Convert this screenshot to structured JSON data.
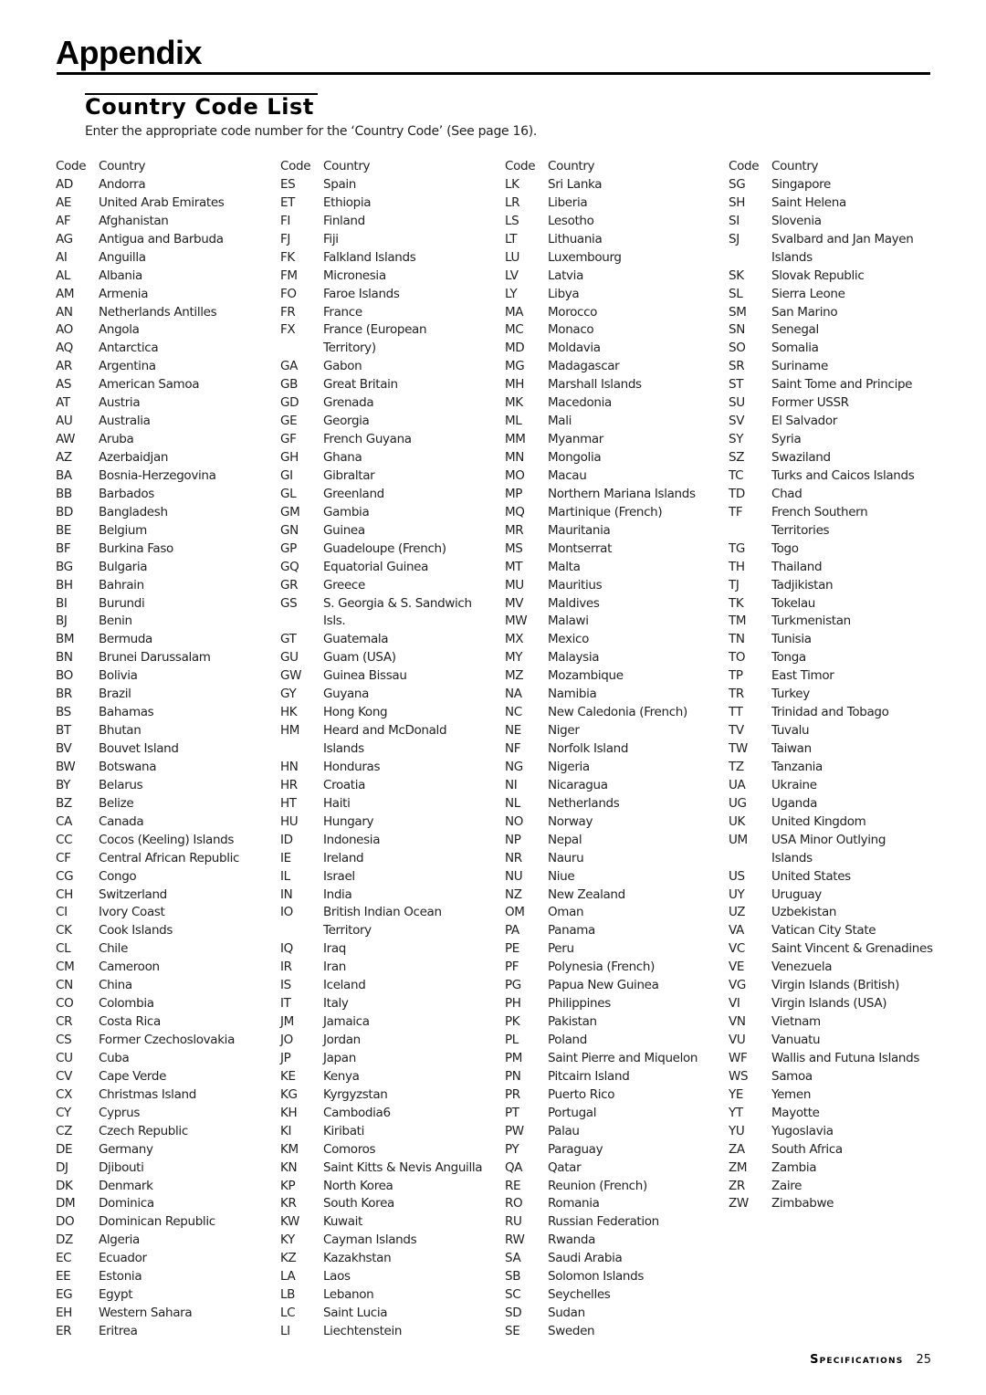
{
  "page": {
    "title": "Appendix",
    "section_title": "Country Code List",
    "intro": "Enter the appropriate code number for the ‘Country Code’ (See page 16).",
    "footer": {
      "section": "Specifications",
      "page_number": "25"
    }
  },
  "table_headers": {
    "code": "Code",
    "country": "Country"
  },
  "columns": [
    [
      [
        "AD",
        "Andorra"
      ],
      [
        "AE",
        "United Arab Emirates"
      ],
      [
        "AF",
        "Afghanistan"
      ],
      [
        "AG",
        "Antigua and Barbuda"
      ],
      [
        "AI",
        "Anguilla"
      ],
      [
        "AL",
        "Albania"
      ],
      [
        "AM",
        "Armenia"
      ],
      [
        "AN",
        "Netherlands Antilles"
      ],
      [
        "AO",
        "Angola"
      ],
      [
        "AQ",
        "Antarctica"
      ],
      [
        "AR",
        "Argentina"
      ],
      [
        "AS",
        "American Samoa"
      ],
      [
        "AT",
        "Austria"
      ],
      [
        "AU",
        "Australia"
      ],
      [
        "AW",
        "Aruba"
      ],
      [
        "AZ",
        "Azerbaidjan"
      ],
      [
        "BA",
        "Bosnia-Herzegovina"
      ],
      [
        "BB",
        "Barbados"
      ],
      [
        "BD",
        "Bangladesh"
      ],
      [
        "BE",
        "Belgium"
      ],
      [
        "BF",
        "Burkina Faso"
      ],
      [
        "BG",
        "Bulgaria"
      ],
      [
        "BH",
        "Bahrain"
      ],
      [
        "BI",
        "Burundi"
      ],
      [
        "BJ",
        "Benin"
      ],
      [
        "BM",
        "Bermuda"
      ],
      [
        "BN",
        "Brunei Darussalam"
      ],
      [
        "BO",
        "Bolivia"
      ],
      [
        "BR",
        "Brazil"
      ],
      [
        "BS",
        "Bahamas"
      ],
      [
        "BT",
        "Bhutan"
      ],
      [
        "BV",
        "Bouvet Island"
      ],
      [
        "BW",
        "Botswana"
      ],
      [
        "BY",
        "Belarus"
      ],
      [
        "BZ",
        "Belize"
      ],
      [
        "CA",
        "Canada"
      ],
      [
        "CC",
        "Cocos (Keeling) Islands"
      ],
      [
        "CF",
        "Central African Republic"
      ],
      [
        "CG",
        "Congo"
      ],
      [
        "CH",
        "Switzerland"
      ],
      [
        "CI",
        "Ivory Coast"
      ],
      [
        "CK",
        "Cook Islands"
      ],
      [
        "CL",
        "Chile"
      ],
      [
        "CM",
        "Cameroon"
      ],
      [
        "CN",
        "China"
      ],
      [
        "CO",
        "Colombia"
      ],
      [
        "CR",
        "Costa Rica"
      ],
      [
        "CS",
        "Former Czechoslovakia"
      ],
      [
        "CU",
        "Cuba"
      ],
      [
        "CV",
        "Cape Verde"
      ],
      [
        "CX",
        "Christmas Island"
      ],
      [
        "CY",
        "Cyprus"
      ],
      [
        "CZ",
        "Czech Republic"
      ],
      [
        "DE",
        "Germany"
      ],
      [
        "DJ",
        "Djibouti"
      ],
      [
        "DK",
        "Denmark"
      ],
      [
        "DM",
        "Dominica"
      ],
      [
        "DO",
        "Dominican Republic"
      ],
      [
        "DZ",
        "Algeria"
      ],
      [
        "EC",
        "Ecuador"
      ],
      [
        "EE",
        "Estonia"
      ],
      [
        "EG",
        "Egypt"
      ],
      [
        "EH",
        "Western Sahara"
      ],
      [
        "ER",
        "Eritrea"
      ]
    ],
    [
      [
        "ES",
        "Spain"
      ],
      [
        "ET",
        "Ethiopia"
      ],
      [
        "FI",
        "Finland"
      ],
      [
        "FJ",
        "Fiji"
      ],
      [
        "FK",
        "Falkland Islands"
      ],
      [
        "FM",
        "Micronesia"
      ],
      [
        "FO",
        "Faroe Islands"
      ],
      [
        "FR",
        "France"
      ],
      [
        "FX",
        "France (European",
        "Territory)"
      ],
      [
        "GA",
        "Gabon"
      ],
      [
        "GB",
        "Great Britain"
      ],
      [
        "GD",
        "Grenada"
      ],
      [
        "GE",
        "Georgia"
      ],
      [
        "GF",
        "French Guyana"
      ],
      [
        "GH",
        "Ghana"
      ],
      [
        "GI",
        "Gibraltar"
      ],
      [
        "GL",
        "Greenland"
      ],
      [
        "GM",
        "Gambia"
      ],
      [
        "GN",
        "Guinea"
      ],
      [
        "GP",
        "Guadeloupe (French)"
      ],
      [
        "GQ",
        "Equatorial Guinea"
      ],
      [
        "GR",
        "Greece"
      ],
      [
        "GS",
        "S. Georgia & S. Sandwich",
        "Isls."
      ],
      [
        "GT",
        "Guatemala"
      ],
      [
        "GU",
        "Guam (USA)"
      ],
      [
        "GW",
        "Guinea Bissau"
      ],
      [
        "GY",
        "Guyana"
      ],
      [
        "HK",
        "Hong Kong"
      ],
      [
        "HM",
        "Heard and McDonald",
        "Islands"
      ],
      [
        "HN",
        "Honduras"
      ],
      [
        "HR",
        "Croatia"
      ],
      [
        "HT",
        "Haiti"
      ],
      [
        "HU",
        "Hungary"
      ],
      [
        "ID",
        "Indonesia"
      ],
      [
        "IE",
        "Ireland"
      ],
      [
        "IL",
        "Israel"
      ],
      [
        "IN",
        "India"
      ],
      [
        "IO",
        "British Indian Ocean",
        "Territory"
      ],
      [
        "IQ",
        "Iraq"
      ],
      [
        "IR",
        "Iran"
      ],
      [
        "IS",
        "Iceland"
      ],
      [
        "IT",
        "Italy"
      ],
      [
        "JM",
        "Jamaica"
      ],
      [
        "JO",
        "Jordan"
      ],
      [
        "JP",
        "Japan"
      ],
      [
        "KE",
        "Kenya"
      ],
      [
        "KG",
        "Kyrgyzstan"
      ],
      [
        "KH",
        "Cambodia6"
      ],
      [
        "KI",
        "Kiribati"
      ],
      [
        "KM",
        "Comoros"
      ],
      [
        "KN",
        "Saint Kitts & Nevis Anguilla"
      ],
      [
        "KP",
        "North Korea"
      ],
      [
        "KR",
        "South Korea"
      ],
      [
        "KW",
        "Kuwait"
      ],
      [
        "KY",
        "Cayman Islands"
      ],
      [
        "KZ",
        "Kazakhstan"
      ],
      [
        "LA",
        "Laos"
      ],
      [
        "LB",
        "Lebanon"
      ],
      [
        "LC",
        "Saint Lucia"
      ],
      [
        "LI",
        "Liechtenstein"
      ]
    ],
    [
      [
        "LK",
        "Sri Lanka"
      ],
      [
        "LR",
        "Liberia"
      ],
      [
        "LS",
        "Lesotho"
      ],
      [
        "LT",
        "Lithuania"
      ],
      [
        "LU",
        "Luxembourg"
      ],
      [
        "LV",
        "Latvia"
      ],
      [
        "LY",
        "Libya"
      ],
      [
        "MA",
        "Morocco"
      ],
      [
        "MC",
        "Monaco"
      ],
      [
        "MD",
        "Moldavia"
      ],
      [
        "MG",
        "Madagascar"
      ],
      [
        "MH",
        "Marshall Islands"
      ],
      [
        "MK",
        "Macedonia"
      ],
      [
        "ML",
        "Mali"
      ],
      [
        "MM",
        "Myanmar"
      ],
      [
        "MN",
        "Mongolia"
      ],
      [
        "MO",
        "Macau"
      ],
      [
        "MP",
        "Northern Mariana Islands"
      ],
      [
        "MQ",
        "Martinique (French)"
      ],
      [
        "MR",
        "Mauritania"
      ],
      [
        "MS",
        "Montserrat"
      ],
      [
        "MT",
        "Malta"
      ],
      [
        "MU",
        "Mauritius"
      ],
      [
        "MV",
        "Maldives"
      ],
      [
        "MW",
        "Malawi"
      ],
      [
        "MX",
        "Mexico"
      ],
      [
        "MY",
        "Malaysia"
      ],
      [
        "MZ",
        "Mozambique"
      ],
      [
        "NA",
        "Namibia"
      ],
      [
        "NC",
        "New Caledonia (French)"
      ],
      [
        "NE",
        "Niger"
      ],
      [
        "NF",
        "Norfolk Island"
      ],
      [
        "NG",
        "Nigeria"
      ],
      [
        "NI",
        "Nicaragua"
      ],
      [
        "NL",
        "Netherlands"
      ],
      [
        "NO",
        "Norway"
      ],
      [
        "NP",
        "Nepal"
      ],
      [
        "NR",
        "Nauru"
      ],
      [
        "NU",
        "Niue"
      ],
      [
        "NZ",
        "New Zealand"
      ],
      [
        "OM",
        "Oman"
      ],
      [
        "PA",
        "Panama"
      ],
      [
        "PE",
        "Peru"
      ],
      [
        "PF",
        "Polynesia (French)"
      ],
      [
        "PG",
        "Papua New Guinea"
      ],
      [
        "PH",
        "Philippines"
      ],
      [
        "PK",
        "Pakistan"
      ],
      [
        "PL",
        "Poland"
      ],
      [
        "PM",
        "Saint Pierre and Miquelon"
      ],
      [
        "PN",
        "Pitcairn Island"
      ],
      [
        "PR",
        "Puerto Rico"
      ],
      [
        "PT",
        "Portugal"
      ],
      [
        "PW",
        "Palau"
      ],
      [
        "PY",
        "Paraguay"
      ],
      [
        "QA",
        "Qatar"
      ],
      [
        "RE",
        "Reunion (French)"
      ],
      [
        "RO",
        "Romania"
      ],
      [
        "RU",
        "Russian Federation"
      ],
      [
        "RW",
        "Rwanda"
      ],
      [
        "SA",
        "Saudi Arabia"
      ],
      [
        "SB",
        "Solomon Islands"
      ],
      [
        "SC",
        "Seychelles"
      ],
      [
        "SD",
        "Sudan"
      ],
      [
        "SE",
        "Sweden"
      ]
    ],
    [
      [
        "SG",
        "Singapore"
      ],
      [
        "SH",
        "Saint Helena"
      ],
      [
        "SI",
        "Slovenia"
      ],
      [
        "SJ",
        "Svalbard and Jan Mayen",
        "Islands"
      ],
      [
        "SK",
        "Slovak Republic"
      ],
      [
        "SL",
        "Sierra Leone"
      ],
      [
        "SM",
        "San Marino"
      ],
      [
        "SN",
        "Senegal"
      ],
      [
        "SO",
        "Somalia"
      ],
      [
        "SR",
        "Suriname"
      ],
      [
        "ST",
        "Saint Tome and Principe"
      ],
      [
        "SU",
        "Former USSR"
      ],
      [
        "SV",
        "El Salvador"
      ],
      [
        "SY",
        "Syria"
      ],
      [
        "SZ",
        "Swaziland"
      ],
      [
        "TC",
        "Turks and Caicos Islands"
      ],
      [
        "TD",
        "Chad"
      ],
      [
        "TF",
        "French Southern",
        "Territories"
      ],
      [
        "TG",
        "Togo"
      ],
      [
        "TH",
        "Thailand"
      ],
      [
        "TJ",
        "Tadjikistan"
      ],
      [
        "TK",
        "Tokelau"
      ],
      [
        "TM",
        "Turkmenistan"
      ],
      [
        "TN",
        "Tunisia"
      ],
      [
        "TO",
        "Tonga"
      ],
      [
        "TP",
        "East Timor"
      ],
      [
        "TR",
        "Turkey"
      ],
      [
        "TT",
        "Trinidad and Tobago"
      ],
      [
        "TV",
        "Tuvalu"
      ],
      [
        "TW",
        "Taiwan"
      ],
      [
        "TZ",
        "Tanzania"
      ],
      [
        "UA",
        "Ukraine"
      ],
      [
        "UG",
        "Uganda"
      ],
      [
        "UK",
        "United Kingdom"
      ],
      [
        "UM",
        "USA Minor Outlying",
        "Islands"
      ],
      [
        "US",
        "United States"
      ],
      [
        "UY",
        "Uruguay"
      ],
      [
        "UZ",
        "Uzbekistan"
      ],
      [
        "VA",
        "Vatican City State"
      ],
      [
        "VC",
        "Saint Vincent & Grenadines"
      ],
      [
        "VE",
        "Venezuela"
      ],
      [
        "VG",
        "Virgin Islands (British)"
      ],
      [
        "VI",
        "Virgin Islands (USA)"
      ],
      [
        "VN",
        "Vietnam"
      ],
      [
        "VU",
        "Vanuatu"
      ],
      [
        "WF",
        "Wallis and Futuna Islands"
      ],
      [
        "WS",
        "Samoa"
      ],
      [
        "YE",
        "Yemen"
      ],
      [
        "YT",
        "Mayotte"
      ],
      [
        "YU",
        "Yugoslavia"
      ],
      [
        "ZA",
        "South Africa"
      ],
      [
        "ZM",
        "Zambia"
      ],
      [
        "ZR",
        "Zaire"
      ],
      [
        "ZW",
        "Zimbabwe"
      ]
    ]
  ]
}
